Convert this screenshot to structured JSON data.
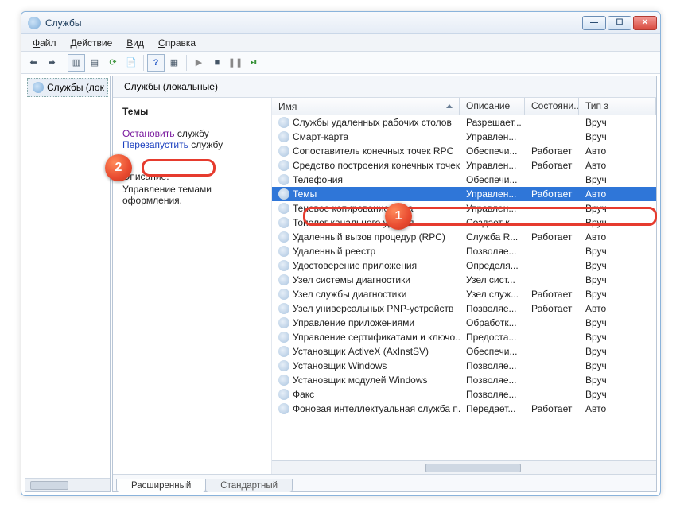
{
  "window": {
    "title": "Службы"
  },
  "menu": {
    "file": "Файл",
    "action": "Действие",
    "view": "Вид",
    "help": "Справка"
  },
  "tree": {
    "root": "Службы (лок"
  },
  "pane_header": "Службы (локальные)",
  "detail": {
    "name": "Темы",
    "stop": "Остановить",
    "stop_tail": " службу",
    "restart": "Перезапустить",
    "restart_tail": " службу",
    "desc_label": "Описание:",
    "desc": "Управление темами оформления."
  },
  "columns": {
    "name": "Имя",
    "desc": "Описание",
    "state": "Состояни...",
    "type": "Тип з"
  },
  "services": [
    {
      "name": "Службы удаленных рабочих столов",
      "desc": "Разрешает...",
      "state": "",
      "type": "Вруч"
    },
    {
      "name": "Смарт-карта",
      "desc": "Управлен...",
      "state": "",
      "type": "Вруч"
    },
    {
      "name": "Сопоставитель конечных точек RPC",
      "desc": "Обеспечи...",
      "state": "Работает",
      "type": "Авто"
    },
    {
      "name": "Средство построения конечных точек...",
      "desc": "Управлен...",
      "state": "Работает",
      "type": "Авто"
    },
    {
      "name": "Телефония",
      "desc": "Обеспечи...",
      "state": "",
      "type": "Вруч"
    },
    {
      "name": "Темы",
      "desc": "Управлен...",
      "state": "Работает",
      "type": "Авто",
      "selected": true
    },
    {
      "name": "Теневое копирование тома",
      "desc": "Управлен...",
      "state": "",
      "type": "Вруч"
    },
    {
      "name": "Тополог канального уровня",
      "desc": "Создает к...",
      "state": "",
      "type": "Вруч"
    },
    {
      "name": "Удаленный вызов процедур (RPC)",
      "desc": "Служба R...",
      "state": "Работает",
      "type": "Авто"
    },
    {
      "name": "Удаленный реестр",
      "desc": "Позволяе...",
      "state": "",
      "type": "Вруч"
    },
    {
      "name": "Удостоверение приложения",
      "desc": "Определя...",
      "state": "",
      "type": "Вруч"
    },
    {
      "name": "Узел системы диагностики",
      "desc": "Узел сист...",
      "state": "",
      "type": "Вруч"
    },
    {
      "name": "Узел службы диагностики",
      "desc": "Узел служ...",
      "state": "Работает",
      "type": "Вруч"
    },
    {
      "name": "Узел универсальных PNP-устройств",
      "desc": "Позволяе...",
      "state": "Работает",
      "type": "Авто"
    },
    {
      "name": "Управление приложениями",
      "desc": "Обработк...",
      "state": "",
      "type": "Вруч"
    },
    {
      "name": "Управление сертификатами и ключо...",
      "desc": "Предоста...",
      "state": "",
      "type": "Вруч"
    },
    {
      "name": "Установщик ActiveX (AxInstSV)",
      "desc": "Обеспечи...",
      "state": "",
      "type": "Вруч"
    },
    {
      "name": "Установщик Windows",
      "desc": "Позволяе...",
      "state": "",
      "type": "Вруч"
    },
    {
      "name": "Установщик модулей Windows",
      "desc": "Позволяе...",
      "state": "",
      "type": "Вруч"
    },
    {
      "name": "Факс",
      "desc": "Позволяе...",
      "state": "",
      "type": "Вруч"
    },
    {
      "name": "Фоновая интеллектуальная служба п...",
      "desc": "Передает...",
      "state": "Работает",
      "type": "Авто"
    }
  ],
  "tabs": {
    "extended": "Расширенный",
    "standard": "Стандартный"
  },
  "badges": {
    "one": "1",
    "two": "2"
  }
}
